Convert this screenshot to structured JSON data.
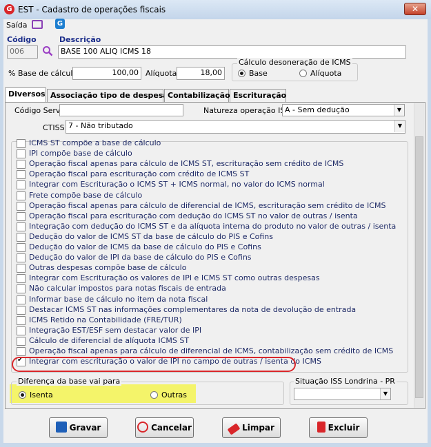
{
  "window": {
    "title": "EST - Cadastro de operações fiscais",
    "close": "✕"
  },
  "toolbar": {
    "mode": "Saída"
  },
  "form": {
    "codigo_label": "Código",
    "codigo_value": "006",
    "descricao_label": "Descrição",
    "descricao_value": "BASE 100 ALIQ ICMS 18",
    "base_calculo_label": "% Base de cálculo",
    "base_calculo_value": "100,00",
    "aliquota_label": "Alíquota",
    "aliquota_value": "18,00",
    "desoneracao_title": "Cálculo desoneração de ICMS",
    "desoneracao_options": [
      "Base",
      "Alíquota"
    ],
    "desoneracao_selected": "Base"
  },
  "tabs": [
    "Diversos",
    "Associação tipo de despesa",
    "Contabilização",
    "Escrituração"
  ],
  "active_tab": "Diversos",
  "diversos": {
    "codigo_servico_label": "Código Servi",
    "codigo_servico_value": "",
    "natureza_label": "Natureza operação ISS",
    "natureza_value": "A - Sem dedução",
    "ctiss_label": "CTISS",
    "ctiss_value": "7 - Não tributado",
    "checkboxes": [
      {
        "label": "ICMS ST compõe a base de cálculo",
        "checked": false
      },
      {
        "label": "IPI compõe base de cálculo",
        "checked": false
      },
      {
        "label": "Operação fiscal apenas para cálculo de ICMS ST, escrituração sem crédito de ICMS",
        "checked": false
      },
      {
        "label": "Operação fiscal para escrituração com crédito de ICMS ST",
        "checked": false
      },
      {
        "label": "Integrar com Escrituração o ICMS ST + ICMS normal,  no valor do ICMS normal",
        "checked": false
      },
      {
        "label": "Frete compõe base de cálculo",
        "checked": false
      },
      {
        "label": "Operação fiscal apenas para cálculo de diferencial de ICMS, escrituração sem crédito de ICMS",
        "checked": false
      },
      {
        "label": "Operação fiscal para escrituração com dedução do ICMS ST no valor de outras / isenta",
        "checked": false
      },
      {
        "label": "Integração com dedução do ICMS ST e da alíquota interna do produto no valor de outras / isenta",
        "checked": false
      },
      {
        "label": "Dedução do valor de ICMS ST da base de cálculo do PIS e Cofins",
        "checked": false
      },
      {
        "label": "Dedução do valor de ICMS da base de cálculo do PIS e Cofins",
        "checked": false
      },
      {
        "label": "Dedução do valor de IPI da base de cálculo do PIS e Cofins",
        "checked": false
      },
      {
        "label": "Outras despesas compõe base de cálculo",
        "checked": false
      },
      {
        "label": "Integrar com Escrituração os valores de IPI e ICMS ST como outras despesas",
        "checked": false
      },
      {
        "label": "Não calcular impostos para notas fiscais de entrada",
        "checked": false
      },
      {
        "label": "Informar base de cálculo no item da nota fiscal",
        "checked": false
      },
      {
        "label": "Destacar ICMS ST nas informações complementares da nota de devolução de entrada",
        "checked": false
      },
      {
        "label": "ICMS Retido na Contabilidade (FRE/TUR)",
        "checked": false
      },
      {
        "label": "Integração EST/ESF sem destacar valor de IPI",
        "checked": false
      },
      {
        "label": "Cálculo de diferencial de alíquota ICMS ST",
        "checked": false
      },
      {
        "label": "Operação fiscal apenas para cálculo de diferencial de ICMS, contabilização sem crédito de ICMS",
        "checked": false
      },
      {
        "label": "Integrar com escrituração o valor de IPI no campo de outras / isenta do ICMS",
        "checked": true
      }
    ],
    "diferenca_title": "Diferença da base vai para",
    "diferenca_options": [
      "Isenta",
      "Outras"
    ],
    "diferenca_selected": "Isenta",
    "situacao_iss_title": "Situação ISS Londrina - PR",
    "situacao_iss_value": ""
  },
  "buttons": {
    "gravar": "Gravar",
    "cancelar": "Cancelar",
    "limpar": "Limpar",
    "excluir": "Excluir"
  },
  "colors": {
    "highlight": "#f4f46a",
    "circle": "#d9262a",
    "label_blue": "#1a2c8a"
  }
}
